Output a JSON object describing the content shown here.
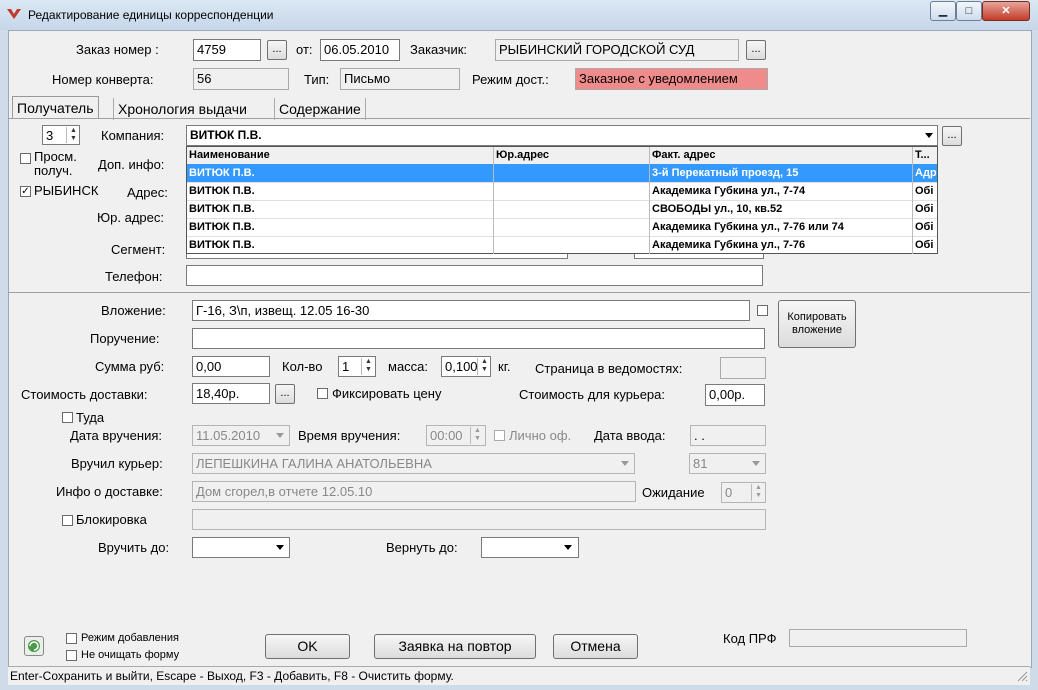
{
  "window": {
    "title": "Редактирование единицы корреспонденции",
    "min": "▁",
    "max": "□",
    "close": "✕"
  },
  "header": {
    "order_label": "Заказ номер :",
    "order_value": "4759",
    "from_label": "от:",
    "from_value": "06.05.2010",
    "customer_label": "Заказчик:",
    "customer_value": "РЫБИНСКИЙ ГОРОДСКОЙ СУД",
    "envelope_label": "Номер конверта:",
    "envelope_value": "56",
    "type_label": "Тип:",
    "type_value": "Письмо",
    "mode_label": "Режим дост.:",
    "mode_value": "Заказное с уведомлением",
    "dots": "..."
  },
  "tabs": [
    {
      "label": "Получатель"
    },
    {
      "label": "Хронология выдачи"
    },
    {
      "label": "Содержание"
    }
  ],
  "recipient": {
    "counter": "3",
    "company_label": "Компания:",
    "company_value": "ВИТЮК П.В.",
    "view_rec_label": "Просм. получ.",
    "extra_label": "Доп. инфо:",
    "city_label": "РЫБИНСК",
    "address_label": "Адрес:",
    "legal_address_label": "Юр. адрес:",
    "segment_label": "Сегмент:",
    "phone_label": "Телефон:"
  },
  "dropdown": {
    "columns": [
      "Наименование",
      "Юр.адрес",
      "Факт. адрес",
      "Т..."
    ],
    "rows": [
      {
        "name": "ВИТЮК П.В.",
        "legal": "",
        "fact": "3-й Перекатный проезд, 15",
        "t": "Адр"
      },
      {
        "name": "ВИТЮК П.В.",
        "legal": "",
        "fact": "Академика Губкина ул., 7-74",
        "t": "Обі"
      },
      {
        "name": "ВИТЮК П.В.",
        "legal": "",
        "fact": "СВОБОДЫ ул., 10, кв.52",
        "t": "Обі"
      },
      {
        "name": "ВИТЮК П.В.",
        "legal": "",
        "fact": "Академика Губкина ул., 7-76 или 74",
        "t": "Обі"
      },
      {
        "name": "ВИТЮК П.В.",
        "legal": "",
        "fact": "Академика Губкина ул., 7-76",
        "t": "Обі"
      }
    ]
  },
  "content": {
    "attachment_label": "Вложение:",
    "attachment_value": "Г-16, З\\п, извещ. 12.05 16-30",
    "copy_button": "Копировать вложение",
    "assignment_label": "Поручение:",
    "sum_label": "Сумма руб:",
    "sum_value": "0,00",
    "qty_label": "Кол-во",
    "qty_value": "1",
    "mass_label": "масса:",
    "mass_value": "0,100",
    "kg_label": "кг.",
    "page_label": "Страница в ведомостях:",
    "delivery_cost_label": "Стоимость доставки:",
    "delivery_cost_value": "18,40р.",
    "fix_price_label": "Фиксировать цену",
    "courier_cost_label": "Стоимость для курьера:",
    "courier_cost_value": "0,00р.",
    "there_label": "Туда",
    "delivery_date_label": "Дата вручения:",
    "delivery_date_value": "11.05.2010",
    "delivery_time_label": "Время вручения:",
    "delivery_time_value": "00:00",
    "personal_label": "Лично оф.",
    "entry_date_label": "Дата ввода:",
    "entry_date_value": ". .",
    "courier_label": "Вручил курьер:",
    "courier_value": "ЛЕПЕШКИНА ГАЛИНА АНАТОЛЬЕВНА",
    "courier_code": "81",
    "info_label": "Инфо о доставке:",
    "info_value": "Дом сгорел,в отчете 12.05.10",
    "wait_label": "Ожидание",
    "wait_value": "0",
    "block_label": "Блокировка",
    "deliver_by_label": "Вручить до:",
    "return_by_label": "Вернуть до:"
  },
  "footer": {
    "add_mode": "Режим добавления",
    "no_clear": "Не очищать форму",
    "ok": "OK",
    "repeat": "Заявка на повтор",
    "cancel": "Отмена",
    "prf_label": "Код ПРФ"
  },
  "status": "Enter-Сохранить и выйти, Escape - Выход, F3 - Добавить, F8 - Очистить форму.",
  "colors": {
    "mode_bg": "#f08b8b",
    "selection": "#3399ff",
    "titlebar": "#c6d7ea"
  }
}
